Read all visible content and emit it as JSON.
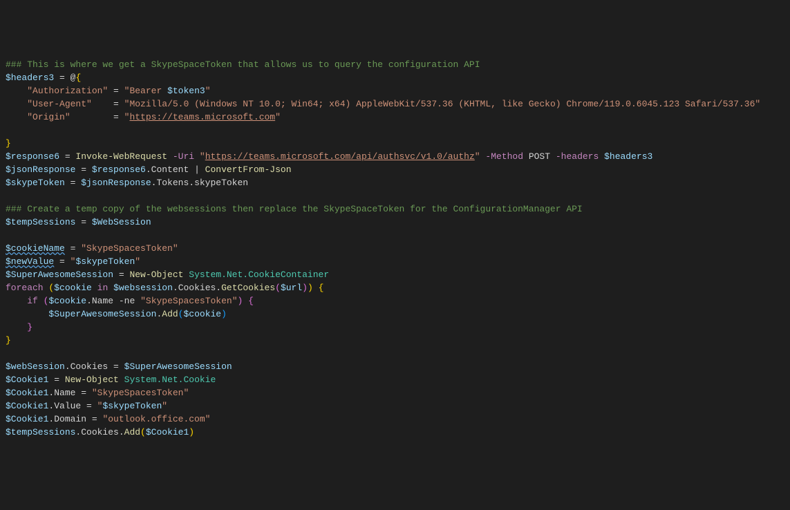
{
  "l1": {
    "c1": "### This is where we get a SkypeSpaceToken that allows us to query the configuration API"
  },
  "l2": {
    "v": "$headers3",
    "eq": " = ",
    "at": "@",
    "br": "{"
  },
  "l3": {
    "k": "\"Authorization\"",
    "eq": " = ",
    "s1": "\"Bearer ",
    "v": "$token3",
    "s2": "\""
  },
  "l4": {
    "k": "\"User-Agent\"",
    "eq": "    = ",
    "s": "\"Mozilla/5.0 (Windows NT 10.0; Win64; x64) AppleWebKit/537.36 (KHTML, like Gecko) Chrome/119.0.6045.123 Safari/537.36\""
  },
  "l5": {
    "k": "\"Origin\"",
    "eq": "        = ",
    "q1": "\"",
    "u": "https://teams.microsoft.com",
    "q2": "\""
  },
  "l7": {
    "br": "}"
  },
  "l8": {
    "v": "$response6",
    "eq": " = ",
    "cmd": "Invoke-WebRequest",
    "sp": " ",
    "p1": "-Uri",
    "sp2": " ",
    "q1": "\"",
    "u": "https://teams.microsoft.com/api/authsvc/v1.0/authz",
    "q2": "\"",
    "sp3": " ",
    "p2": "-Method",
    "sp4": " ",
    "arg": "POST",
    "sp5": " ",
    "p3": "-headers",
    "sp6": " ",
    "v2": "$headers3"
  },
  "l9": {
    "v": "$jsonResponse",
    "eq": " = ",
    "v2": "$response6",
    "m": ".Content",
    "pipe": " | ",
    "cmd": "ConvertFrom-Json"
  },
  "l10": {
    "v": "$skypeToken",
    "eq": " = ",
    "v2": "$jsonResponse",
    "m": ".Tokens.skypeToken"
  },
  "l12": {
    "c": "### Create a temp copy of the websessions then replace the SkypeSpaceToken for the ConfigurationManager API"
  },
  "l13": {
    "v": "$tempSessions",
    "eq": " = ",
    "v2": "$WebSession"
  },
  "l15": {
    "v": "$cookieName",
    "eq": " = ",
    "s": "\"SkypeSpacesToken\""
  },
  "l16": {
    "v": "$newValue",
    "eq": " = ",
    "q1": "\"",
    "iv": "$skypeToken",
    "q2": "\""
  },
  "l17": {
    "v": "$SuperAwesomeSession",
    "eq": " = ",
    "cmd": "New-Object",
    "sp": " ",
    "t": "System.Net.CookieContainer"
  },
  "l18": {
    "kw": "foreach",
    "sp": " ",
    "p1": "(",
    "v": "$cookie",
    "in": " in ",
    "v2": "$websession",
    "m": ".Cookies.",
    "fn": "GetCookies",
    "p2": "(",
    "v3": "$url",
    "p3": ")",
    "p4": ")",
    "sp2": " ",
    "br": "{"
  },
  "l19": {
    "kw": "if",
    "sp": " ",
    "p1": "(",
    "v": "$cookie",
    "m": ".Name",
    "op": " -ne ",
    "s": "\"SkypeSpacesToken\"",
    "p2": ")",
    "sp2": " ",
    "br": "{"
  },
  "l20": {
    "v": "$SuperAwesomeSession",
    "m": ".",
    "fn": "Add",
    "p1": "(",
    "v2": "$cookie",
    "p2": ")"
  },
  "l21": {
    "br": "}"
  },
  "l22": {
    "br": "}"
  },
  "l24": {
    "v": "$webSession",
    "m": ".Cookies",
    "eq": " = ",
    "v2": "$SuperAwesomeSession"
  },
  "l25": {
    "v": "$Cookie1",
    "eq": " = ",
    "cmd": "New-Object",
    "sp": " ",
    "t": "System.Net.Cookie"
  },
  "l26": {
    "v": "$Cookie1",
    "m": ".Name",
    "eq": " = ",
    "s": "\"SkypeSpacesToken\""
  },
  "l27": {
    "v": "$Cookie1",
    "m": ".Value",
    "eq": " = ",
    "q1": "\"",
    "iv": "$skypeToken",
    "q2": "\""
  },
  "l28": {
    "v": "$Cookie1",
    "m": ".Domain",
    "eq": " = ",
    "s": "\"outlook.office.com\""
  },
  "l29": {
    "v": "$tempSessions",
    "m": ".Cookies.",
    "fn": "Add",
    "p1": "(",
    "v2": "$Cookie1",
    "p2": ")"
  }
}
